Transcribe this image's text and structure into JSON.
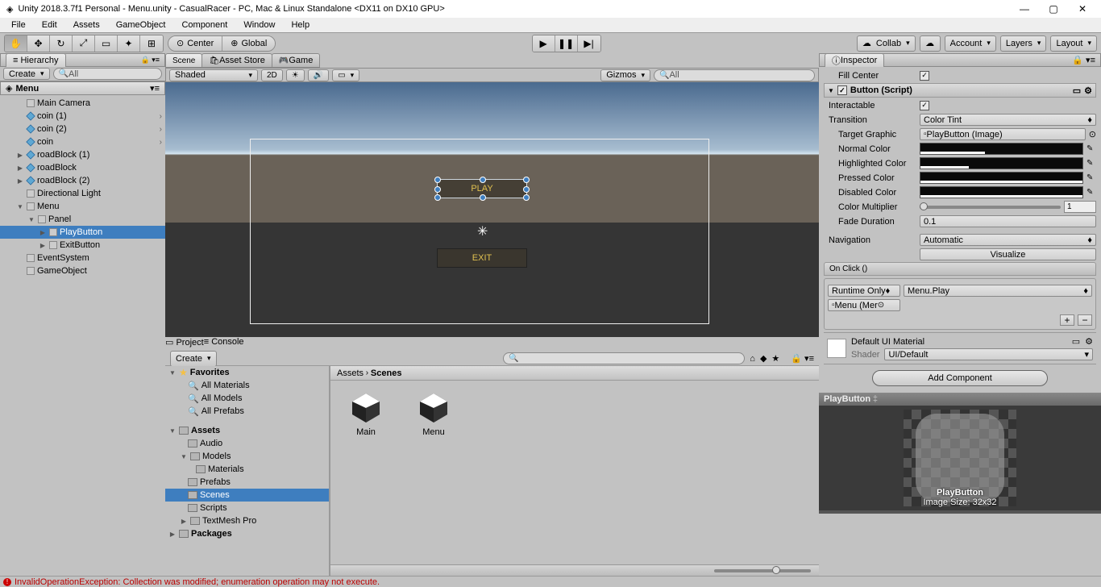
{
  "window": {
    "title": "Unity 2018.3.7f1 Personal - Menu.unity - CasualRacer - PC, Mac & Linux Standalone <DX11 on DX10 GPU>"
  },
  "menubar": [
    "File",
    "Edit",
    "Assets",
    "GameObject",
    "Component",
    "Window",
    "Help"
  ],
  "toolbar": {
    "center": "Center",
    "global": "Global",
    "collab": "Collab",
    "account": "Account",
    "layers": "Layers",
    "layout": "Layout"
  },
  "hierarchy": {
    "tab": "Hierarchy",
    "create": "Create",
    "search_ph": "All",
    "scene_name": "Menu",
    "items": [
      {
        "label": "Main Camera",
        "indent": 1,
        "type": "go"
      },
      {
        "label": "coin (1)",
        "indent": 1,
        "type": "cube",
        "exp": false,
        "chev": true
      },
      {
        "label": "coin (2)",
        "indent": 1,
        "type": "cube",
        "exp": false,
        "chev": true
      },
      {
        "label": "coin",
        "indent": 1,
        "type": "cube",
        "exp": false,
        "chev": true
      },
      {
        "label": "roadBlock (1)",
        "indent": 1,
        "type": "cube",
        "arrow": true
      },
      {
        "label": "roadBlock",
        "indent": 1,
        "type": "cube",
        "arrow": true
      },
      {
        "label": "roadBlock (2)",
        "indent": 1,
        "type": "cube",
        "arrow": true
      },
      {
        "label": "Directional Light",
        "indent": 1,
        "type": "go"
      },
      {
        "label": "Menu",
        "indent": 1,
        "type": "go",
        "arrow": true,
        "open": true
      },
      {
        "label": "Panel",
        "indent": 2,
        "type": "go",
        "arrow": true,
        "open": true
      },
      {
        "label": "PlayButton",
        "indent": 3,
        "type": "go",
        "arrow": true,
        "sel": true
      },
      {
        "label": "ExitButton",
        "indent": 3,
        "type": "go",
        "arrow": true
      },
      {
        "label": "EventSystem",
        "indent": 1,
        "type": "go"
      },
      {
        "label": "GameObject",
        "indent": 1,
        "type": "go"
      }
    ]
  },
  "scene": {
    "tabs": [
      "Scene",
      "Asset Store",
      "Game"
    ],
    "shading": "Shaded",
    "btn2d": "2D",
    "gizmos": "Gizmos",
    "search_ph": "All",
    "play_label": "PLAY",
    "exit_label": "EXIT"
  },
  "project": {
    "tabs": [
      "Project",
      "Console"
    ],
    "create": "Create",
    "favorites": "Favorites",
    "fav_items": [
      "All Materials",
      "All Models",
      "All Prefabs"
    ],
    "assets": "Assets",
    "folders": [
      "Audio",
      "Models",
      "Materials",
      "Prefabs",
      "Scenes",
      "Scripts",
      "TextMesh Pro"
    ],
    "packages": "Packages",
    "crumb_root": "Assets",
    "crumb_leaf": "Scenes",
    "assets_list": [
      "Main",
      "Menu"
    ]
  },
  "inspector": {
    "tab": "Inspector",
    "fill_center": "Fill Center",
    "component": "Button (Script)",
    "interactable": "Interactable",
    "transition": "Transition",
    "transition_val": "Color Tint",
    "target_graphic": "Target Graphic",
    "target_graphic_val": "PlayButton (Image)",
    "normal": "Normal Color",
    "highlighted": "Highlighted Color",
    "pressed": "Pressed Color",
    "disabled": "Disabled Color",
    "multiplier": "Color Multiplier",
    "multiplier_val": "1",
    "fade": "Fade Duration",
    "fade_val": "0.1",
    "navigation": "Navigation",
    "navigation_val": "Automatic",
    "visualize": "Visualize",
    "onclick": "On Click ()",
    "runtime": "Runtime Only",
    "func": "Menu.Play",
    "target_obj": "Menu (Mer",
    "material": "Default UI Material",
    "shader_lbl": "Shader",
    "shader_val": "UI/Default",
    "add_component": "Add Component",
    "preview_name": "PlayButton",
    "preview_caption": "PlayButton",
    "preview_size": "Image Size: 32x32"
  },
  "status": {
    "error": "InvalidOperationException: Collection was modified; enumeration operation may not execute."
  }
}
